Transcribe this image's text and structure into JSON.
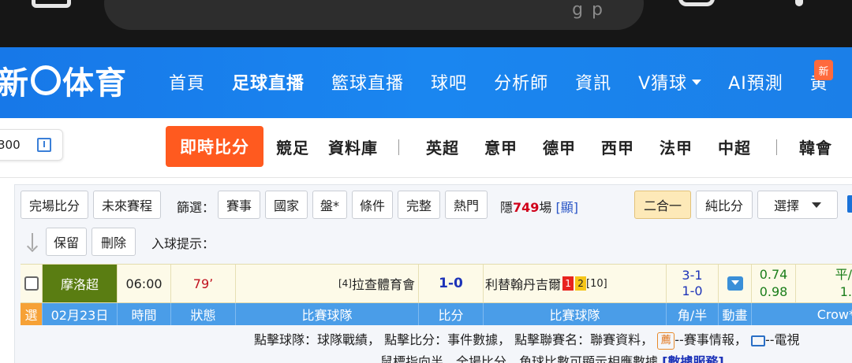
{
  "browser": {
    "url_fragment": "g p"
  },
  "header": {
    "logo_text_1": "新",
    "logo_text_2": "体育",
    "nav": [
      "首頁",
      "足球直播",
      "籃球直播",
      "球吧",
      "分析師",
      "資訊",
      "V猜球",
      "AI預測",
      "黄"
    ],
    "new_badge": "新"
  },
  "subnav": {
    "clock_value": "300",
    "live": "即時比分",
    "items": [
      "競足",
      "資料庫",
      "英超",
      "意甲",
      "德甲",
      "西甲",
      "法甲",
      "中超",
      "韓會"
    ]
  },
  "toolbar": {
    "full_score": "完場比分",
    "future": "未來賽程",
    "filter_label": "篩選：",
    "filters": [
      "賽事",
      "國家",
      "盤*",
      "條件",
      "完整",
      "熱門"
    ],
    "hidden_prefix": "隱",
    "hidden_count": "749",
    "hidden_suffix": "場",
    "show_link": "[顯]",
    "combo": "二合一",
    "pure_score": "純比分",
    "select": "選擇",
    "keep": "保留",
    "delete": "刪除",
    "goal_hint": "入球提示："
  },
  "match": {
    "league": "摩洛超",
    "time": "06:00",
    "minute": "79",
    "home_rank": "[4]",
    "home": "拉查體育會",
    "score": "1-0",
    "away": "利替翰丹吉爾",
    "red_cards": "1",
    "yellow_cards": "2",
    "away_rank": "[10]",
    "corners": "3-1",
    "half": "1-0",
    "odds_home": "0.74",
    "odds_away": "0.98",
    "handicap_top": "平/",
    "handicap_bottom": "1."
  },
  "table_header": {
    "select": "選",
    "date": "02月23日",
    "time": "時間",
    "status": "狀態",
    "home": "比賽球隊",
    "score": "比分",
    "away": "比賽球隊",
    "corner": "角/半",
    "anim": "動畫",
    "company": "Crow*"
  },
  "hint": {
    "line1_a": "點擊球隊：球隊戰績， 點擊比分：事件數據， 點擊聯賽名：聯賽資料，",
    "badge": "薦",
    "line1_b": "--賽事情報，",
    "line1_c": "--電視",
    "line2": "鼠標指向半、全場比分、角球比數可顯示相應數據",
    "line2_link": "[數據服務]"
  }
}
